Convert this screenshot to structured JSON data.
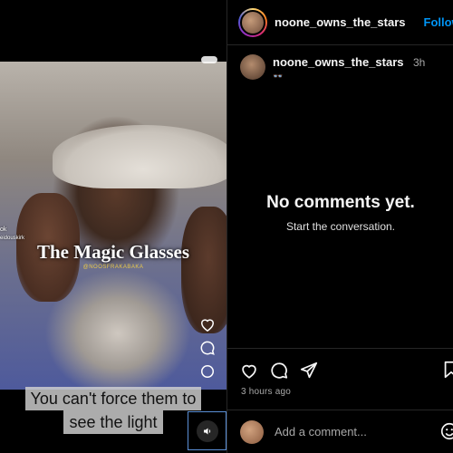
{
  "video": {
    "title": "The Magic Glasses",
    "tag": "@NOOSFRAKABAKA",
    "side_text_1": "ok",
    "side_text_2": "eidouskirk",
    "subtitle_line1": "You can't force them to",
    "subtitle_line2": "see the light",
    "sound_icon": "speaker-icon"
  },
  "header": {
    "username": "noone_owns_the_stars",
    "follow_label": "Follow"
  },
  "caption": {
    "username": "noone_owns_the_stars",
    "time": "3h",
    "emoji": "👓"
  },
  "comments": {
    "empty_title": "No comments yet.",
    "empty_subtitle": "Start the conversation."
  },
  "actions": {
    "icons": [
      "heart-icon",
      "comment-icon",
      "share-icon",
      "bookmark-icon"
    ],
    "post_time": "3 hours ago"
  },
  "comment_box": {
    "placeholder": "Add a comment...",
    "emoji_icon": "smiley-icon"
  },
  "colors": {
    "accent": "#0095f6",
    "background": "#000000",
    "divider": "#262626"
  }
}
